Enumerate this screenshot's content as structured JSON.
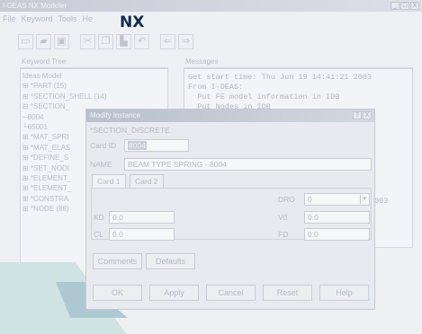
{
  "window": {
    "title": "I-DEAS NX Modeler",
    "buttons": [
      "_",
      "□",
      "X"
    ]
  },
  "menu": [
    "File",
    "Keyword",
    "Tools",
    "He"
  ],
  "logo": "NX",
  "toolbar": {
    "icons": [
      "new-icon",
      "open-icon",
      "save-icon",
      "cut-icon",
      "copy-icon",
      "paste-icon",
      "undo-icon",
      "back-icon",
      "forward-icon"
    ],
    "glyphs": [
      "▭",
      "▰",
      "▣",
      "✂",
      "❐",
      "▙",
      "↶",
      "⇐",
      "⇒"
    ]
  },
  "left_panel": {
    "title": "Keyword Tree",
    "items": [
      "Ideas Model",
      "⊞ *PART (15)",
      "⊞ *SECTION_SHELL (14)",
      "⊟ *SECTION_",
      "   ─8004",
      "   └65001",
      "⊞ *MAT_SPRI",
      "⊞ *MAT_ELAS",
      "⊞ *DEFINE_S",
      "⊞ *SET_NODI",
      "⊞ *ELEMENT_",
      "⊞ *ELEMENT_",
      "⊞ *CONSTRA",
      "⊞ *NODE (88)"
    ]
  },
  "right_panel": {
    "title": "Messages",
    "lines": [
      "Get start time: Thu Jun 19 14:41:21 2003",
      "From I-DEAS:",
      "  Put FE model information in IDB",
      "  Put Nodes in IDB"
    ],
    "extra": "003"
  },
  "dialog": {
    "title": "Modify Instance",
    "title_buttons": [
      "?",
      "X"
    ],
    "section": "*SECTION_DISCRETE",
    "card_id_label": "Card ID",
    "card_id_value": "8004",
    "name_label": "NAME",
    "name_value": "BEAM TYPE SPRING - 8004",
    "tabs": [
      "Card 1",
      "Card 2"
    ],
    "dro_label": "DRO",
    "dro_value": "0",
    "kd_label": "KD",
    "kd_value": "0.0",
    "v0_label": "V0",
    "v0_value": "0.0",
    "cl_label": "CL",
    "cl_value": "0.0",
    "fd_label": "FD",
    "fd_value": "0.0",
    "comments_button": "Comments",
    "defaults_button": "Defaults",
    "ok_button": "OK",
    "apply_button": "Apply",
    "cancel_button": "Cancel",
    "reset_button": "Reset",
    "help_button": "Help"
  }
}
